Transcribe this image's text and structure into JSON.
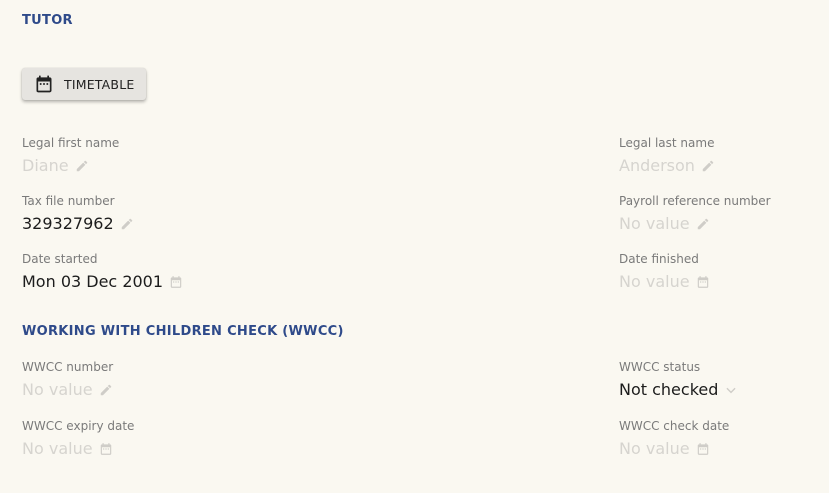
{
  "sections": {
    "tutor": "TUTOR",
    "wwcc": "WORKING WITH CHILDREN CHECK (WWCC)"
  },
  "timetable_button": {
    "label": "TIMETABLE",
    "icon": "calendar-icon"
  },
  "fields": {
    "legal_first_name": {
      "label": "Legal first name",
      "value": "Diane",
      "icon": "pencil-icon"
    },
    "legal_last_name": {
      "label": "Legal last name",
      "value": "Anderson",
      "icon": "pencil-icon"
    },
    "tax_file_number": {
      "label": "Tax file number",
      "value": "329327962",
      "icon": "pencil-icon"
    },
    "payroll_reference_number": {
      "label": "Payroll reference number",
      "value": "No value",
      "icon": "pencil-icon"
    },
    "date_started": {
      "label": "Date started",
      "value": "Mon 03 Dec 2001",
      "icon": "calendar-icon"
    },
    "date_finished": {
      "label": "Date finished",
      "value": "No value",
      "icon": "calendar-icon"
    },
    "wwcc_number": {
      "label": "WWCC number",
      "value": "No value",
      "icon": "pencil-icon"
    },
    "wwcc_status": {
      "label": "WWCC status",
      "value": "Not checked",
      "icon": "chevron-down-icon"
    },
    "wwcc_expiry_date": {
      "label": "WWCC expiry date",
      "value": "No value",
      "icon": "calendar-icon"
    },
    "wwcc_check_date": {
      "label": "WWCC check date",
      "value": "No value",
      "icon": "calendar-icon"
    }
  },
  "colors": {
    "background": "#faf8f1",
    "section_heading": "#2e4a8a",
    "label": "#7a7a7a",
    "value": "#1c1c1c",
    "placeholder": "#d6d4cf",
    "field_icon": "#cfcdc8"
  }
}
